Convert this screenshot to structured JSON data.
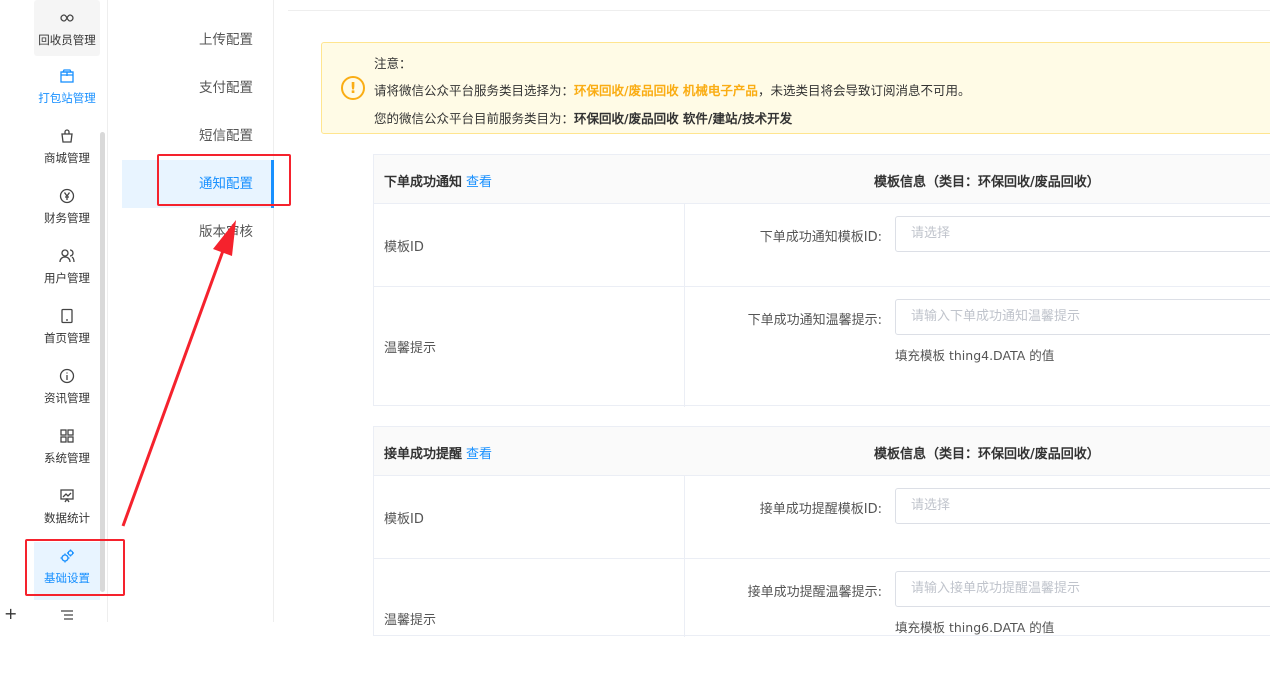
{
  "main_nav": [
    {
      "label": "回收员管理",
      "icon": "infinity-icon"
    },
    {
      "label": "打包站管理",
      "icon": "package-icon"
    },
    {
      "label": "商城管理",
      "icon": "bag-icon"
    },
    {
      "label": "财务管理",
      "icon": "yen-icon"
    },
    {
      "label": "用户管理",
      "icon": "users-icon"
    },
    {
      "label": "首页管理",
      "icon": "tablet-icon"
    },
    {
      "label": "资讯管理",
      "icon": "info-icon"
    },
    {
      "label": "系统管理",
      "icon": "grid-icon"
    },
    {
      "label": "数据统计",
      "icon": "chart-icon"
    },
    {
      "label": "基础设置",
      "icon": "gears-icon"
    }
  ],
  "sub_nav": [
    "上传配置",
    "支付配置",
    "短信配置",
    "通知配置",
    "版本审核"
  ],
  "plus_sign": "+",
  "alert": {
    "title": "注意：",
    "line2_prefix": "请将微信公众平台服务类目选择为：",
    "line2_highlight": "环保回收/废品回收  机械电子产品",
    "line2_suffix": "，未选类目将会导致订阅消息不可用。",
    "line3_prefix": "您的微信公众平台目前服务类目为：",
    "line3_bold": "环保回收/废品回收 软件/建站/技术开发"
  },
  "sections": [
    {
      "title": "下单成功通知",
      "link": "查看",
      "template_info": "模板信息（类目：环保回收/废品回收）",
      "row1_left": "模板ID",
      "row1_label": "下单成功通知模板ID:",
      "row1_placeholder": "请选择",
      "row2_left": "温馨提示",
      "row2_label": "下单成功通知温馨提示:",
      "row2_placeholder": "请输入下单成功通知温馨提示",
      "row2_hint": "填充模板 thing4.DATA 的值"
    },
    {
      "title": "接单成功提醒",
      "link": "查看",
      "template_info": "模板信息（类目：环保回收/废品回收）",
      "row1_left": "模板ID",
      "row1_label": "接单成功提醒模板ID:",
      "row1_placeholder": "请选择",
      "row2_left": "温馨提示",
      "row2_label": "接单成功提醒温馨提示:",
      "row2_placeholder": "请输入接单成功提醒温馨提示",
      "row2_hint": "填充模板 thing6.DATA 的值"
    }
  ],
  "colors": {
    "accent": "#1890ff",
    "warning": "#faad14",
    "annotation": "#f5222d"
  }
}
